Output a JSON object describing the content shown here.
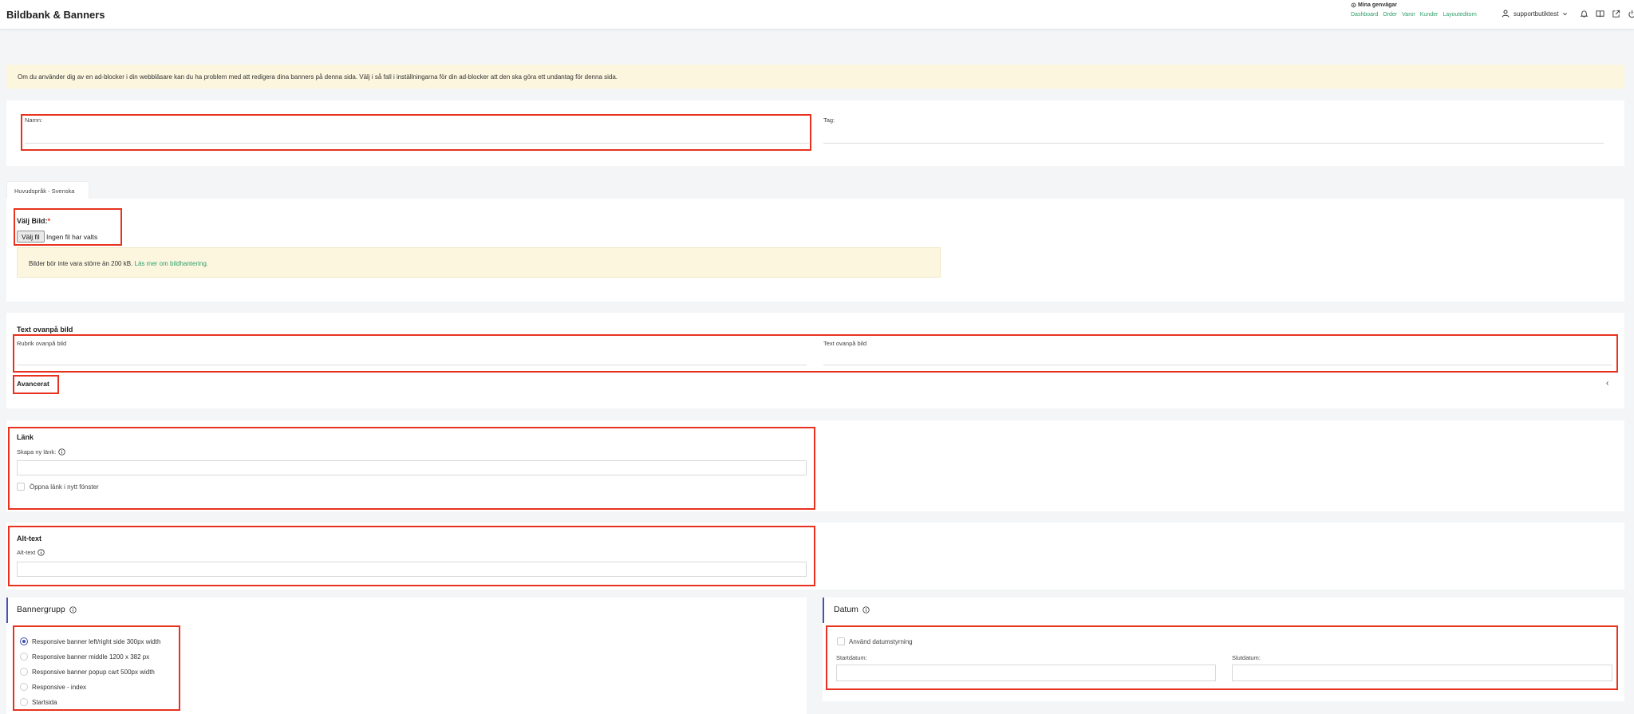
{
  "header": {
    "title": "Bildbank & Banners",
    "shortcuts_title": "Mina genvägar",
    "shortcuts": [
      "Dashboard",
      "Order",
      "Varor",
      "Kunder",
      "Layouteditorn"
    ],
    "username": "supportbutiktest"
  },
  "alert": {
    "text": "Om du använder dig av en ad-blocker i din webbläsare kan du ha problem med att redigera dina banners på denna sida. Välj i så fall i inställningarna för din ad-blocker att den ska göra ett undantag för denna sida."
  },
  "main": {
    "name_label": "Namn:",
    "name_value": "",
    "tag_label": "Tag:",
    "tag_value": ""
  },
  "language_tab": "Huvudspråk - Svenska",
  "image": {
    "label": "Välj Bild:",
    "required_mark": "*",
    "file_button": "Välj fil",
    "file_status": "Ingen fil har valts",
    "note_text": "Bilder bör inte vara större än 200 kB.",
    "note_link": "Läs mer om bildhantering."
  },
  "overlay": {
    "section_title": "Text ovanpå bild",
    "heading_label": "Rubrik ovanpå bild",
    "text_label": "Text ovanpå bild",
    "advanced": "Avancerat"
  },
  "link": {
    "section_title": "Länk",
    "create_label": "Skapa ny länk:",
    "new_window_label": "Öppna länk i nytt fönster"
  },
  "alt": {
    "section_title": "Alt-text",
    "field_label": "Alt-text"
  },
  "banner_group": {
    "title": "Bannergrupp",
    "options": [
      "Responsive banner left/right side 300px width",
      "Responsive banner middle 1200 x 382 px",
      "Responsive banner popup cart 500px width",
      "Responsive - index",
      "Startsida"
    ],
    "selected_index": 0
  },
  "date": {
    "title": "Datum",
    "use_label": "Använd datumstyrning",
    "start_label": "Startdatum:",
    "end_label": "Slutdatum:"
  },
  "colors": {
    "highlight_red": "#e8321f",
    "link_green": "#2e9f6b",
    "accent_blue": "#3f4fb0",
    "alert_bg": "#fcf6df"
  }
}
